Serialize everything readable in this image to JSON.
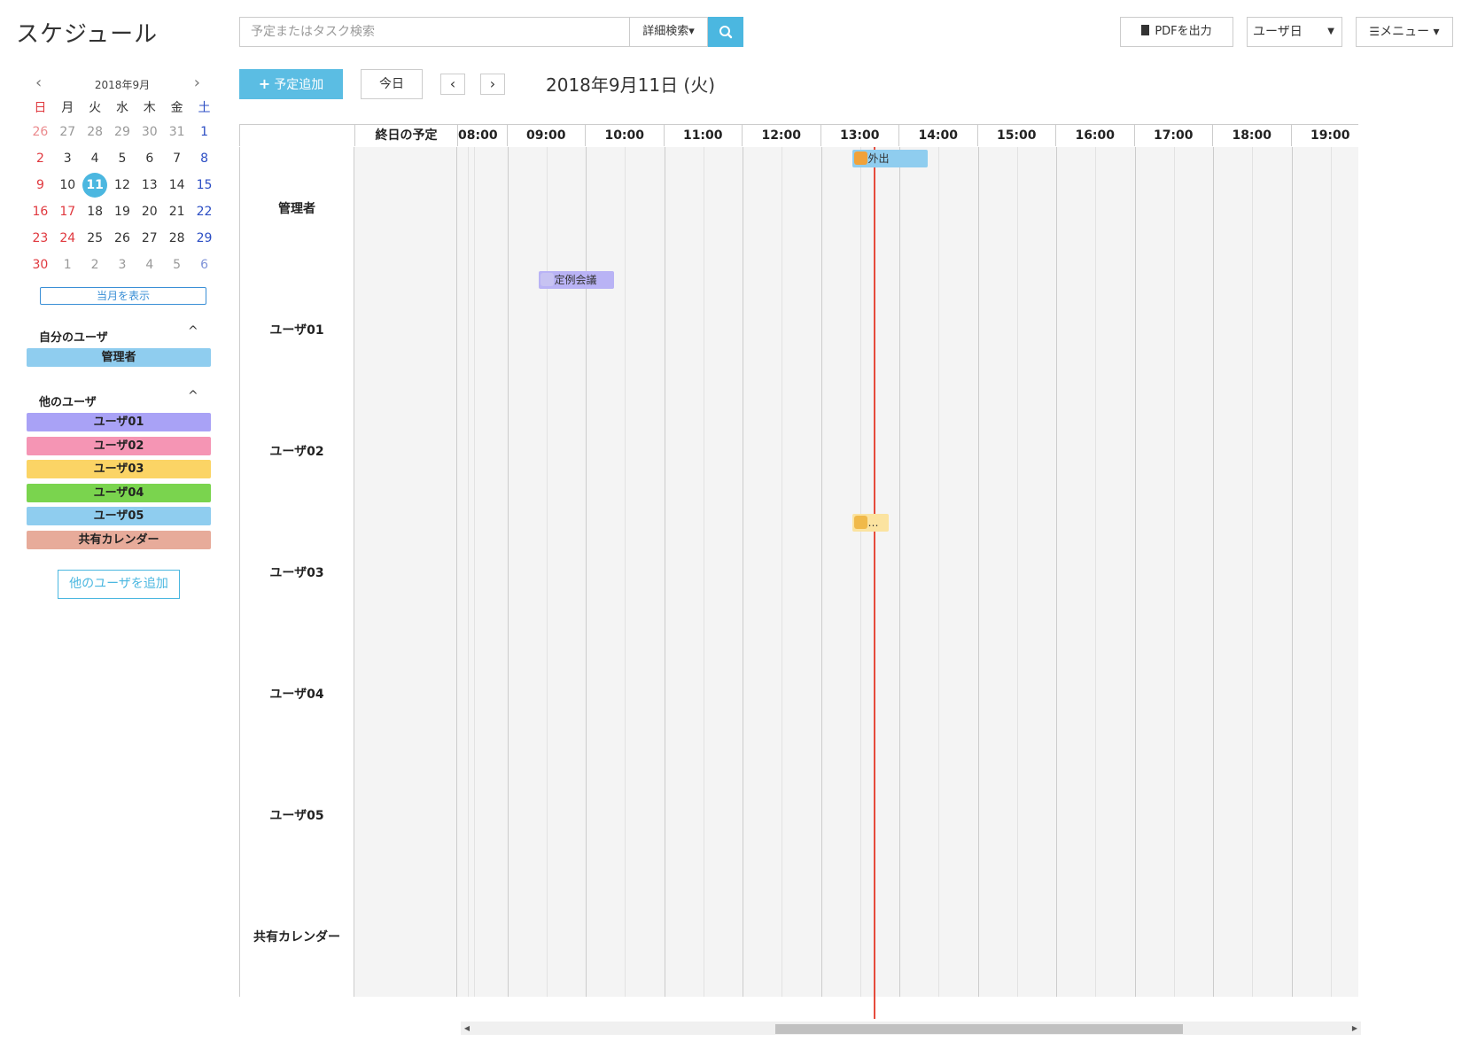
{
  "app": {
    "title": "スケジュール"
  },
  "search": {
    "placeholder": "予定またはタスク検索",
    "advanced_label": "詳細検索▾"
  },
  "top_actions": {
    "pdf_label": "PDFを出力",
    "view_label": "ユーザ日",
    "menu_label": "メニュー ▾"
  },
  "toolbar": {
    "add_label": "予定追加",
    "today_label": "今日",
    "prev_label": "‹",
    "next_label": "›",
    "date_title": "2018年9月11日 (火)"
  },
  "mini_calendar": {
    "month_label": "2018年9月",
    "weekdays": [
      "日",
      "月",
      "火",
      "水",
      "木",
      "金",
      "土"
    ],
    "weeks": [
      [
        "26",
        "27",
        "28",
        "29",
        "30",
        "31",
        "1"
      ],
      [
        "2",
        "3",
        "4",
        "5",
        "6",
        "7",
        "8"
      ],
      [
        "9",
        "10",
        "11",
        "12",
        "13",
        "14",
        "15"
      ],
      [
        "16",
        "17",
        "18",
        "19",
        "20",
        "21",
        "22"
      ],
      [
        "23",
        "24",
        "25",
        "26",
        "27",
        "28",
        "29"
      ],
      [
        "30",
        "1",
        "2",
        "3",
        "4",
        "5",
        "6"
      ]
    ],
    "dim_cells": [
      [
        0,
        0
      ],
      [
        0,
        1
      ],
      [
        0,
        2
      ],
      [
        0,
        3
      ],
      [
        0,
        4
      ],
      [
        0,
        5
      ],
      [
        5,
        1
      ],
      [
        5,
        2
      ],
      [
        5,
        3
      ],
      [
        5,
        4
      ],
      [
        5,
        5
      ],
      [
        5,
        6
      ]
    ],
    "today_cell": [
      2,
      2
    ],
    "holiday_cells": [
      [
        3,
        1
      ],
      [
        4,
        1
      ]
    ],
    "show_month_label": "当月を表示"
  },
  "my_users": {
    "title": "自分のユーザ",
    "items": [
      {
        "label": "管理者",
        "color": "#8fcdef"
      }
    ]
  },
  "other_users": {
    "title": "他のユーザ",
    "items": [
      {
        "label": "ユーザ01",
        "color": "#a9a2f6"
      },
      {
        "label": "ユーザ02",
        "color": "#f595b4"
      },
      {
        "label": "ユーザ03",
        "color": "#fbd465"
      },
      {
        "label": "ユーザ04",
        "color": "#7ad44e"
      },
      {
        "label": "ユーザ05",
        "color": "#8fcdef"
      },
      {
        "label": "共有カレンダー",
        "color": "#e7ab9a"
      }
    ],
    "add_label": "他のユーザを追加"
  },
  "grid": {
    "allday_label": "終日の予定",
    "hours": [
      "08:00",
      "09:00",
      "10:00",
      "11:00",
      "12:00",
      "13:00",
      "14:00",
      "15:00",
      "16:00",
      "17:00",
      "18:00",
      "19:00"
    ],
    "rows": [
      {
        "label": "管理者"
      },
      {
        "label": "ユーザ01"
      },
      {
        "label": "ユーザ02"
      },
      {
        "label": "ユーザ03"
      },
      {
        "label": "ユーザ04"
      },
      {
        "label": "ユーザ05"
      },
      {
        "label": "共有カレンダー"
      }
    ],
    "events": [
      {
        "row": 0,
        "start": "13:00",
        "end": "14:00",
        "title": "外出",
        "color": "#8fcdef",
        "icon_color": "#f0a23a",
        "icon": "person-walking-icon"
      },
      {
        "row": 1,
        "start": "09:00",
        "end": "10:00",
        "title": "定例会議",
        "color": "#b9b3f5",
        "icon_color": "#c7c3f2",
        "icon": "meeting-icon"
      },
      {
        "row": 3,
        "start": "13:00",
        "end": "13:30",
        "title": "…",
        "color": "#fbe3a0",
        "icon_color": "#f0b94a",
        "icon": "person-walking-icon"
      }
    ],
    "now": "13:18"
  },
  "colors": {
    "accent": "#4bb7e0",
    "now_line": "#e64b3c",
    "sunday": "#e0383e",
    "saturday": "#2c4ec4"
  }
}
